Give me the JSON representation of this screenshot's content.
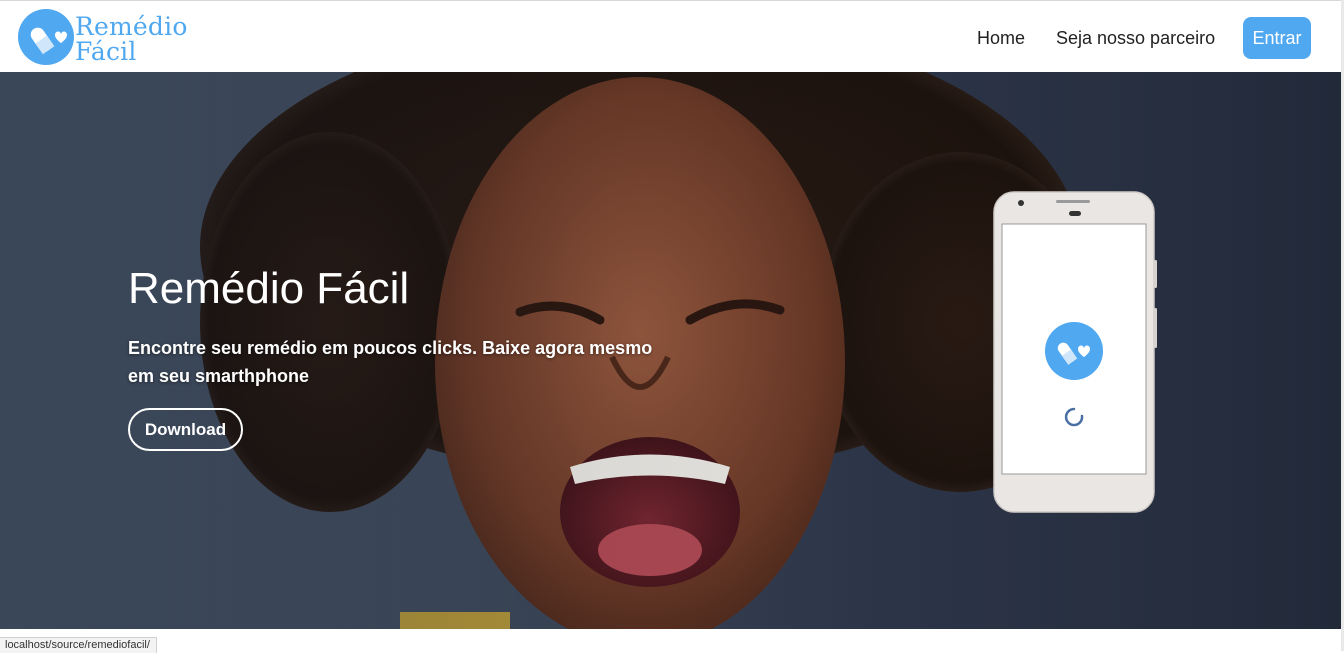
{
  "brand": {
    "name_line1": "Remédio",
    "name_line2": "Fácil",
    "logo_icon": "pill-heart-icon",
    "color": "#4fa8f0"
  },
  "nav": {
    "home": "Home",
    "partner": "Seja nosso parceiro",
    "login": "Entrar"
  },
  "hero": {
    "title": "Remédio Fácil",
    "subtitle": "Encontre seu remédio em poucos clicks. Baixe agora mesmo em seu smarthphone",
    "download": "Download",
    "photo": "smiling-woman-photo",
    "phone_icon": "pill-heart-icon",
    "loading_icon": "spinner-icon"
  },
  "status_bar": {
    "url": "localhost/source/remediofacil/"
  }
}
